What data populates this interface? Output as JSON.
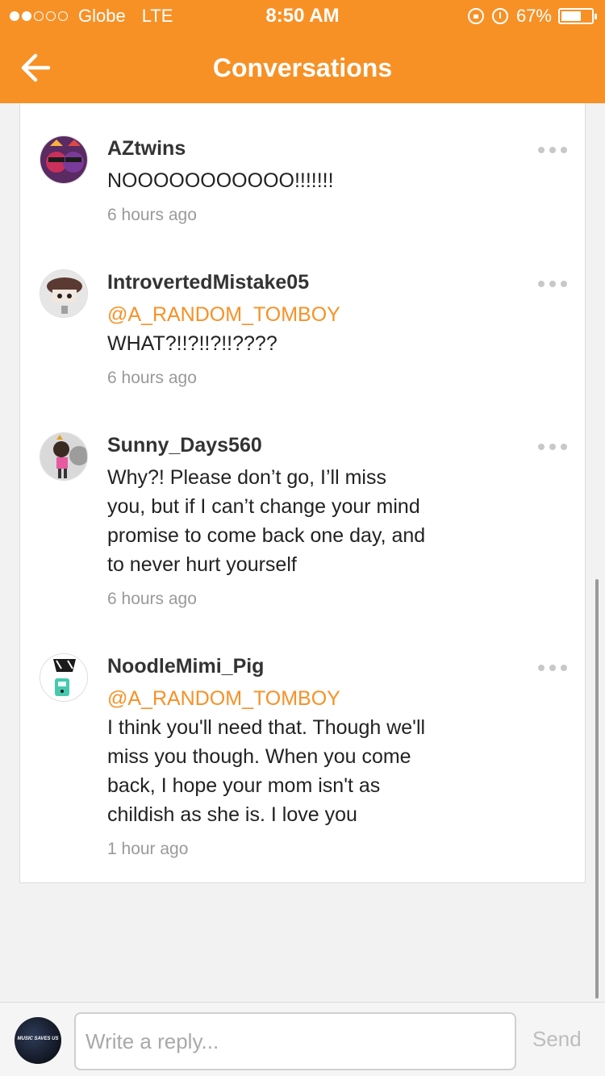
{
  "status_bar": {
    "carrier": "Globe",
    "network": "LTE",
    "time": "8:50 AM",
    "battery_pct_label": "67%",
    "battery_level": 0.67,
    "signal_bars": 2
  },
  "nav": {
    "title": "Conversations"
  },
  "comments": [
    {
      "username": "AZtwins",
      "mention": "",
      "text": "NOOOOOOOOOOO!!!!!!!",
      "time": "6 hours ago",
      "avatar_icon": "avatar-icon"
    },
    {
      "username": "IntrovertedMistake05",
      "mention": "@A_RANDOM_TOMBOY",
      "text": "WHAT?!!?!!?!!????",
      "time": "6 hours ago",
      "avatar_icon": "avatar-icon"
    },
    {
      "username": "Sunny_Days560",
      "mention": "",
      "text": "Why?! Please don’t go, I’ll miss you, but if I can’t change your mind promise to come back one day, and to never hurt yourself",
      "time": "6 hours ago",
      "avatar_icon": "avatar-icon"
    },
    {
      "username": "NoodleMimi_Pig",
      "mention": "@A_RANDOM_TOMBOY",
      "text": "I think you'll need that. Though we'll miss you though. When you come back, I hope your mom isn't as childish as she is. I love you",
      "time": "1 hour ago",
      "avatar_icon": "avatar-icon"
    }
  ],
  "footer": {
    "my_avatar_text": "MUSIC SAVES US",
    "reply_placeholder": "Write a reply...",
    "send_label": "Send"
  },
  "colors": {
    "accent": "#f79126",
    "mention": "#f79126"
  }
}
